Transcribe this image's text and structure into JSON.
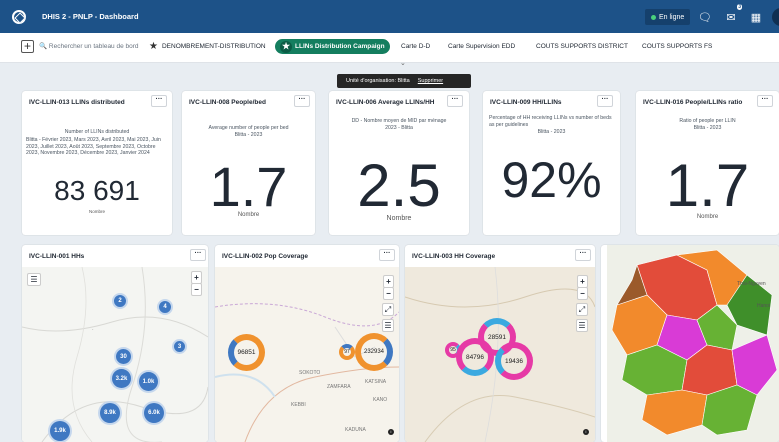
{
  "app": {
    "title": "DHIS 2 - PNLP - Dashboard",
    "online_label": "En ligne",
    "messages_badge": "3"
  },
  "filterbar": {
    "search_placeholder": "Rechercher un tableau de bord",
    "chips": [
      "DENOMBREMENT-DISTRIBUTION",
      "LLINs Distribution Campaign",
      "Carte D-D",
      "Carte Supervision EDD",
      "COUTS SUPPORTS DISTRICT",
      "COUTS SUPPORTS FS"
    ]
  },
  "tooltip": {
    "text": "Unité d'organisation: Blitta",
    "delete_label": "Supprimer"
  },
  "cards": [
    {
      "title": "IVC-LLIN-013 LLINs distributed",
      "desc1": "Number of LLINs distributed",
      "desc2": "Blitta - Février 2023, Mars 2023, Avril 2023, Mai 2023, Juin 2023, Juillet 2023, Août 2023, Septembre 2023, Octobre 2023, Novembre 2023, Décembre 2023, Janvier 2024",
      "value": "83 691",
      "unit": "Nombre"
    },
    {
      "title": "IVC-LLIN-008 People/bed",
      "desc1": "Average number of people per bed",
      "desc2": "Blitta - 2023",
      "value": "1.7",
      "unit": "Nombre"
    },
    {
      "title": "IVC-LLIN-006 Average LLINs/HH",
      "desc1": "DD - Nombre moyen de MID par ménage",
      "desc2": "2023 - Blitta",
      "value": "2.5",
      "unit": "Nombre"
    },
    {
      "title": "IVC-LLIN-009 HH/LLINs",
      "desc1": "Percentage of HH receiving LLINs vs number of beds as per guidelines",
      "desc2": "Blitta - 2023",
      "value": "92%",
      "unit": ""
    },
    {
      "title": "IVC-LLIN-016 People/LLINs ratio",
      "desc1": "Ratio of people per LLIN",
      "desc2": "Blitta - 2023",
      "value": "1.7",
      "unit": "Nombre"
    }
  ],
  "maps": [
    {
      "title": "IVC-LLIN-001 HHs",
      "clusters": [
        "2",
        "4",
        "3",
        "30",
        "3.2k",
        "1.0k",
        "8.9k",
        "6.0k",
        "1.9k"
      ]
    },
    {
      "title": "IVC-LLIN-002 Pop Coverage",
      "rings": [
        "96851",
        "97",
        "232934"
      ],
      "labels": [
        "SOKOTO",
        "ZAMFARA",
        "KATSINA",
        "KANO",
        "KEBBI",
        "KADUNA"
      ]
    },
    {
      "title": "IVC-LLIN-003 HH Coverage",
      "rings": [
        "28591",
        "95",
        "84796",
        "19436"
      ]
    },
    {
      "title": "",
      "labels": [
        "Thai-Nguyen",
        "Hanoi"
      ]
    }
  ],
  "colors": {
    "brand": "#1d5288",
    "active_chip": "#147e5f"
  }
}
